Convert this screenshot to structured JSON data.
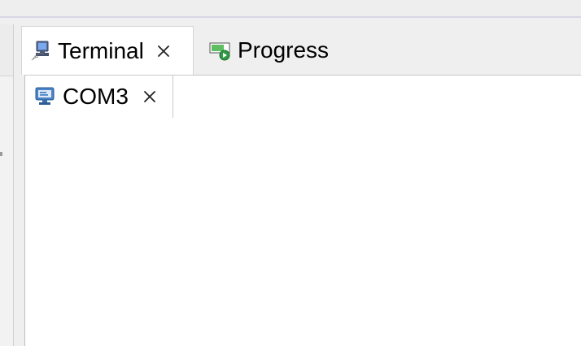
{
  "tabs": [
    {
      "label": "Terminal",
      "icon": "terminal-icon",
      "active": true,
      "closable": true
    },
    {
      "label": "Progress",
      "icon": "progress-icon",
      "active": false,
      "closable": false
    }
  ],
  "subtabs": [
    {
      "label": "COM3",
      "icon": "monitor-icon",
      "closable": true
    }
  ]
}
